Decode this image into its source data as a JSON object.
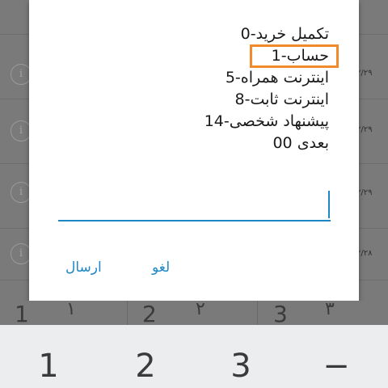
{
  "background": {
    "dates": [
      "۲/۲۹",
      "۲/۲۹",
      "۲/۲۹",
      "۲/۲۸"
    ],
    "info_glyph": "i"
  },
  "dialog": {
    "lines": [
      "0-تکمیل خرید",
      "1-حساب",
      "5-اینترنت همراه",
      "8-اینترنت ثابت",
      "14-پیشنهاد شخصی",
      "00 بعدی"
    ],
    "input_value": "",
    "cancel_label": "لغو",
    "send_label": "ارسال",
    "highlight_color": "#f08a2a",
    "accent_color": "#1e88c7"
  },
  "keyboard": {
    "row_dimmed": [
      "1",
      "۱",
      "2",
      "۲",
      "3",
      "۳"
    ],
    "keys": [
      "1",
      "2",
      "3",
      "−"
    ]
  }
}
